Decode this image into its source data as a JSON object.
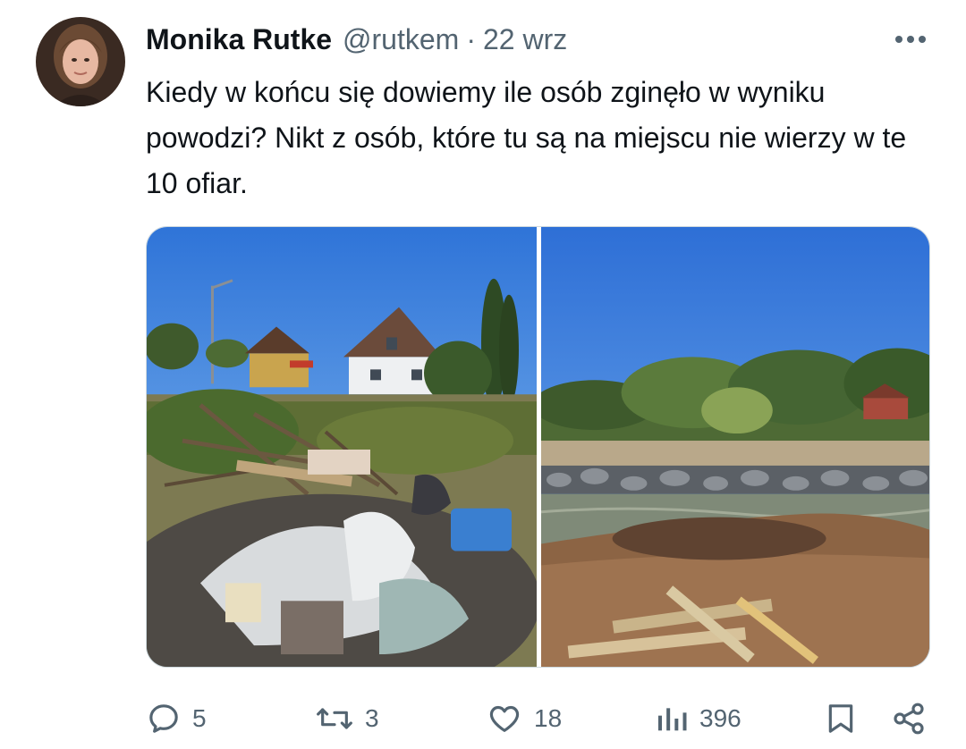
{
  "tweet": {
    "author_name": "Monika Rutke",
    "author_handle": "@rutkem",
    "separator": "·",
    "date": "22 wrz",
    "text": "Kiedy w końcu się dowiemy ile osób zginęło w wyniku powodzi? Nikt z osób, które tu są na miejscu nie wierzy w te 10 ofiar.",
    "avatar_icon": "profile-photo",
    "more_icon": "more-dots-icon",
    "media": [
      {
        "kind": "photo",
        "subject": "flood debris pile in front of houses"
      },
      {
        "kind": "photo",
        "subject": "river bank with stones and mud"
      }
    ]
  },
  "actions": {
    "replies": {
      "icon": "reply-icon",
      "count": "5"
    },
    "retweets": {
      "icon": "retweet-icon",
      "count": "3"
    },
    "likes": {
      "icon": "like-icon",
      "count": "18"
    },
    "views": {
      "icon": "views-icon",
      "count": "396"
    },
    "bookmark": {
      "icon": "bookmark-icon"
    },
    "share": {
      "icon": "share-icon"
    }
  },
  "colors": {
    "text_primary": "#0f1419",
    "text_secondary": "#536471",
    "border": "#cfd9de"
  }
}
